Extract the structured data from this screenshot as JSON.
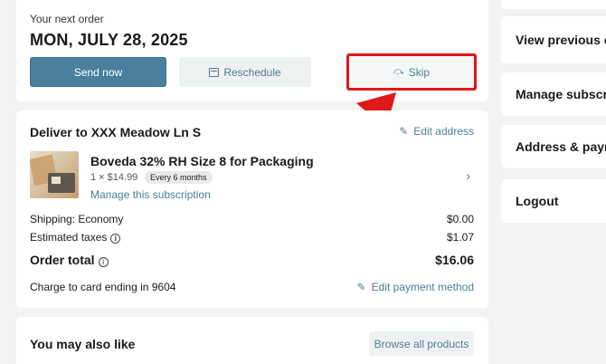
{
  "order": {
    "next_label": "Your next order",
    "date": "MON, JULY 28, 2025",
    "buttons": {
      "send_now": "Send now",
      "reschedule": "Reschedule",
      "skip": "Skip"
    }
  },
  "delivery": {
    "title": "Deliver to XXX Meadow Ln S",
    "edit_address": "Edit address",
    "product": {
      "name": "Boveda 32% RH Size 8 for Packaging",
      "qty_price": "1 × $14.99",
      "frequency": "Every 6 months",
      "manage": "Manage this subscription"
    },
    "shipping_label": "Shipping: Economy",
    "shipping_value": "$0.00",
    "tax_label": "Estimated taxes",
    "tax_value": "$1.07",
    "total_label": "Order total",
    "total_value": "$16.06",
    "card_label": "Charge to card ending in 9604",
    "edit_payment": "Edit payment method"
  },
  "also_like": {
    "title": "You may also like",
    "browse": "Browse all products"
  },
  "sidebar": {
    "items": [
      {
        "label": "View previous o"
      },
      {
        "label": "Manage subscr"
      },
      {
        "label": "Address & payn"
      },
      {
        "label": "Logout"
      }
    ]
  },
  "colors": {
    "accent": "#4a7f9e",
    "highlight": "#e01818",
    "background": "#f3f3f1"
  }
}
